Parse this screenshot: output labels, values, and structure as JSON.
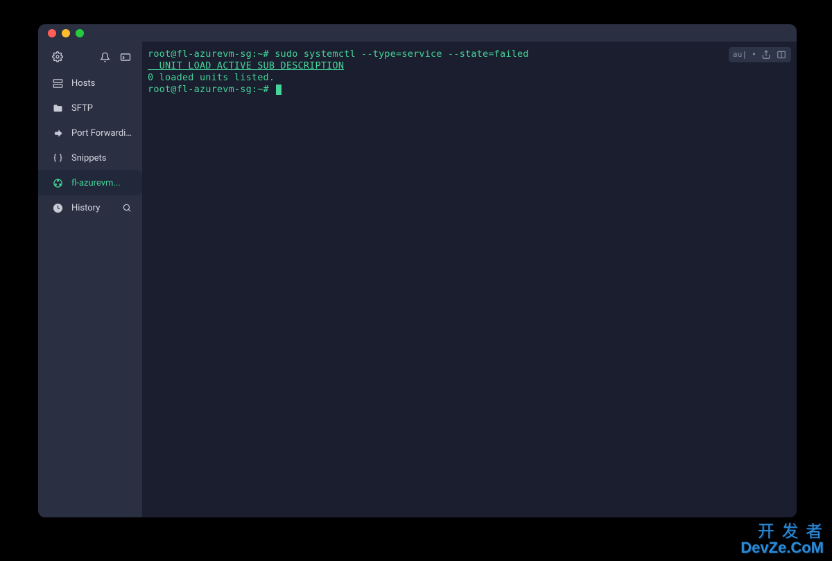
{
  "sidebar": {
    "items": [
      {
        "label": "Hosts"
      },
      {
        "label": "SFTP"
      },
      {
        "label": "Port Forwarding"
      },
      {
        "label": "Snippets"
      },
      {
        "label": "fl-azurevm..."
      },
      {
        "label": "History"
      }
    ]
  },
  "terminal": {
    "toolbar_text": "au| •",
    "lines": [
      {
        "text": "root@fl-azurevm-sg:~# sudo systemctl --type=service --state=failed"
      },
      {
        "text": "  UNIT LOAD ACTIVE SUB DESCRIPTION",
        "underline": true
      },
      {
        "text": "0 loaded units listed."
      },
      {
        "text": "root@fl-azurevm-sg:~# ",
        "cursor": true
      }
    ]
  },
  "watermark": {
    "line1": "开 发 者",
    "line2": "DevZe.CoM"
  }
}
